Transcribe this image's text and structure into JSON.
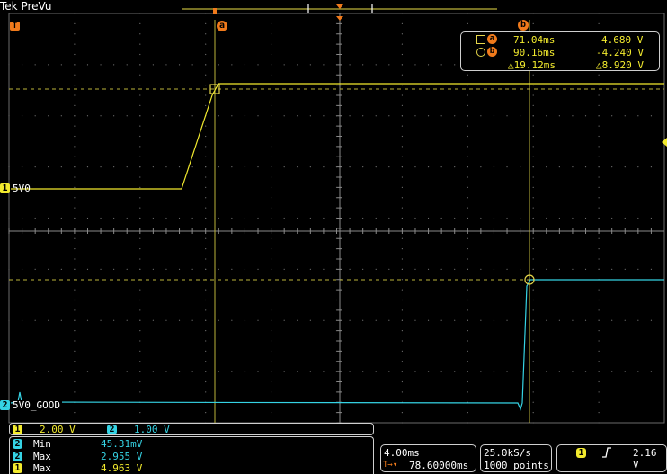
{
  "header": {
    "brand": "Tek",
    "mode": "PreVu"
  },
  "markers": {
    "trigger": "T",
    "cursor_a": "a",
    "cursor_b": "b"
  },
  "channels": [
    {
      "number": "1",
      "name": "5V0",
      "color": "#f2ea2e"
    },
    {
      "number": "2",
      "name": "5V0_GOOD",
      "color": "#35d3e4"
    }
  ],
  "cursor_readout": {
    "a": {
      "time": "71.04ms",
      "value": "4.680 V"
    },
    "b": {
      "time": "90.16ms",
      "value": "-4.240 V"
    },
    "delta": {
      "time": "△19.12ms",
      "value": "△8.920 V"
    }
  },
  "scales": {
    "ch1": {
      "number": "1",
      "value": "2.00 V"
    },
    "ch2": {
      "number": "2",
      "value": "1.00 V"
    }
  },
  "measurements": [
    {
      "channel": "2",
      "label": "Min",
      "value": "45.31mV"
    },
    {
      "channel": "2",
      "label": "Max",
      "value": "2.955 V"
    },
    {
      "channel": "1",
      "label": "Max",
      "value": "4.963 V"
    }
  ],
  "timebase": {
    "scale": "4.00ms",
    "position": "78.60000ms",
    "position_prefix": "T→▾"
  },
  "acquisition": {
    "rate": "25.0kS/s",
    "points": "1000 points"
  },
  "trigger": {
    "channel": "1",
    "slope_icon": "rising-edge-icon",
    "level": "2.16 V"
  },
  "colors": {
    "ch1": "#f2ea2e",
    "ch2": "#35d3e4",
    "cursor": "#bdb43a",
    "marker": "#f07a1b",
    "grid": "#7a7a7a"
  }
}
